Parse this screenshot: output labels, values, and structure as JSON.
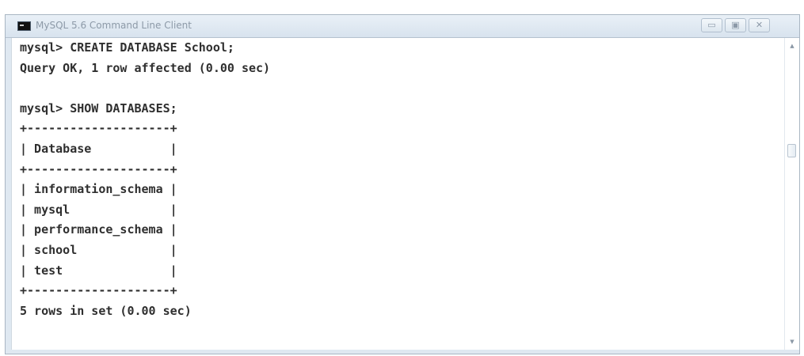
{
  "window": {
    "title": "MySQL 5.6 Command Line Client",
    "icon": "console-icon",
    "buttons": {
      "minimize": "▭",
      "maximize": "▣",
      "close": "✕"
    }
  },
  "console": {
    "lines": [
      "mysql> CREATE DATABASE School;",
      "Query OK, 1 row affected (0.00 sec)",
      "",
      "mysql> SHOW DATABASES;",
      "+--------------------+",
      "| Database           |",
      "+--------------------+",
      "| information_schema |",
      "| mysql              |",
      "| performance_schema |",
      "| school             |",
      "| test               |",
      "+--------------------+",
      "5 rows in set (0.00 sec)"
    ],
    "text": "mysql> CREATE DATABASE School;\nQuery OK, 1 row affected (0.00 sec)\n\nmysql> SHOW DATABASES;\n+--------------------+\n| Database           |\n+--------------------+\n| information_schema |\n| mysql              |\n| performance_schema |\n| school             |\n| test               |\n+--------------------+\n5 rows in set (0.00 sec)",
    "query_result": {
      "column": "Database",
      "rows": [
        "information_schema",
        "mysql",
        "performance_schema",
        "school",
        "test"
      ],
      "summary": "5 rows in set (0.00 sec)"
    }
  },
  "scrollbar": {
    "up_arrow": "▲",
    "down_arrow": "▼"
  },
  "colors": {
    "titlebar": "#e3ebf3",
    "console_background": "#ffffff",
    "console_text": "#2f2f2f",
    "window_border": "#a9b6c3"
  }
}
